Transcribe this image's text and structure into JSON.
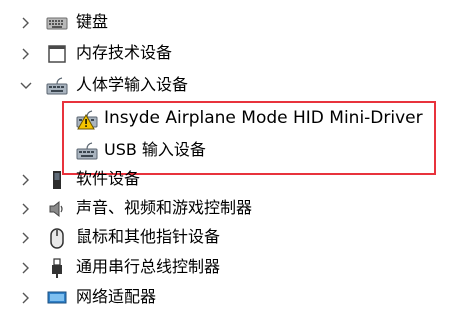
{
  "tree": {
    "keyboard": {
      "label": "键盘",
      "icon": "keyboard-icon"
    },
    "memory_tech": {
      "label": "内存技术设备",
      "icon": "memory-device-icon"
    },
    "hid": {
      "label": "人体学输入设备",
      "icon": "hid-device-icon",
      "expanded": true,
      "children": [
        {
          "label": "Insyde Airplane Mode HID Mini-Driver",
          "icon": "warning-hid-icon"
        },
        {
          "label": "USB 输入设备",
          "icon": "hid-device-icon"
        }
      ]
    },
    "software_devices": {
      "label": "软件设备",
      "icon": "software-device-icon"
    },
    "audio": {
      "label": "声音、视频和游戏控制器",
      "icon": "speaker-icon"
    },
    "mouse": {
      "label": "鼠标和其他指针设备",
      "icon": "mouse-icon"
    },
    "usb_controllers": {
      "label": "通用串行总线控制器",
      "icon": "usb-plug-icon"
    },
    "network": {
      "label": "网络适配器",
      "icon": "network-adapter-icon"
    }
  },
  "colors": {
    "highlight": "#e8323c",
    "warning": "#f5c400"
  }
}
